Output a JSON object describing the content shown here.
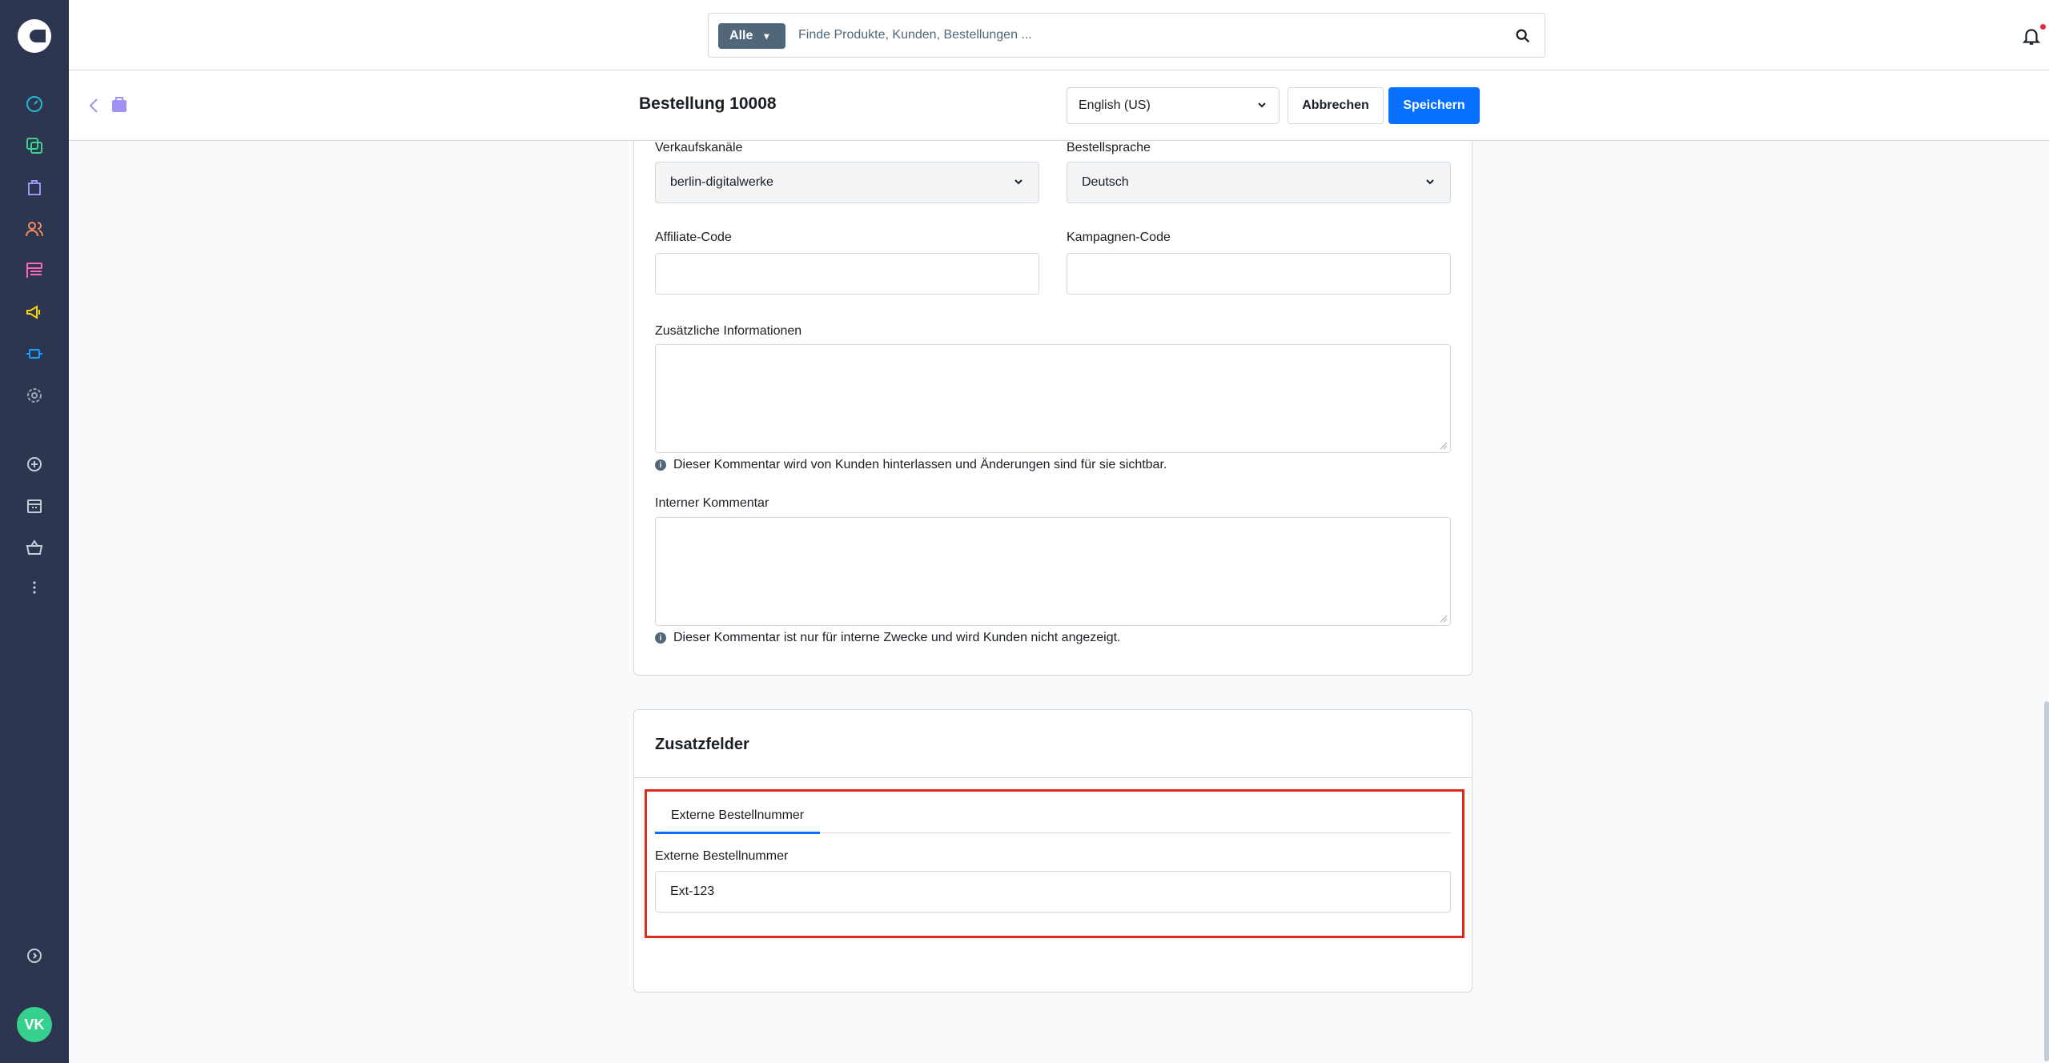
{
  "sidebar": {
    "icons": [
      "dashboard-icon",
      "catalogues-icon",
      "orders-icon",
      "customers-icon",
      "content-icon",
      "marketing-icon",
      "extensions-icon",
      "settings-icon",
      "add-icon",
      "sales-channel-icon",
      "basket-icon",
      "more-icon",
      "collapse-icon"
    ],
    "avatar_initials": "VK"
  },
  "search": {
    "type_label": "Alle",
    "placeholder": "Finde Produkte, Kunden, Bestellungen ..."
  },
  "header": {
    "title": "Bestellung 10008",
    "language": "English (US)",
    "cancel_label": "Abbrechen",
    "save_label": "Speichern"
  },
  "details": {
    "sales_channel_label": "Verkaufskanäle",
    "sales_channel_value": "berlin-digitalwerke",
    "order_language_label": "Bestellsprache",
    "order_language_value": "Deutsch",
    "affiliate_label": "Affiliate-Code",
    "affiliate_value": "",
    "campaign_label": "Kampagnen-Code",
    "campaign_value": "",
    "additional_info_label": "Zusätzliche Informationen",
    "additional_info_hint": "Dieser Kommentar wird von Kunden hinterlassen und Änderungen sind für sie sichtbar.",
    "internal_comment_label": "Interner Kommentar",
    "internal_comment_hint": "Dieser Kommentar ist nur für interne Zwecke und wird Kunden nicht angezeigt."
  },
  "custom_fields": {
    "title": "Zusatzfelder",
    "tab_label": "Externe Bestellnummer",
    "field_label": "Externe Bestellnummer",
    "field_value": "Ext-123"
  },
  "colors": {
    "sidebar_bg": "#2c3650",
    "primary": "#0870ff",
    "highlight": "#e02b20"
  }
}
